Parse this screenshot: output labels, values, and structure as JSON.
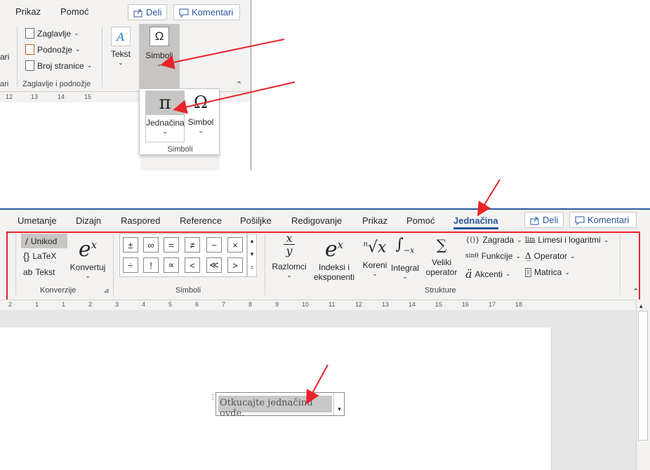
{
  "top": {
    "tabs": [
      "Prikaz",
      "Pomoć"
    ],
    "share_label": "Deli",
    "comments_label": "Komentari",
    "partial_left_text": "ari",
    "header_footer": {
      "items": [
        "Zaglavlje",
        "Podnožje",
        "Broj stranice"
      ],
      "group_label": "Zaglavlje i podnožje"
    },
    "text_button": "Tekst",
    "symbols_button": "Simboli",
    "ruler_ticks": [
      "12",
      "13",
      "14",
      "15"
    ],
    "dropdown": {
      "equation_label": "Jednačina",
      "symbol_label": "Simbol",
      "group_label": "Simboli"
    }
  },
  "bottom": {
    "tabs": [
      "Umetanje",
      "Dizajn",
      "Raspored",
      "Reference",
      "Pošiljke",
      "Redigovanje",
      "Prikaz",
      "Pomoć",
      "Jednačina"
    ],
    "active_tab": "Jednačina",
    "share_label": "Deli",
    "comments_label": "Komentari",
    "conversion": {
      "options": [
        "Unikod",
        "LaTeX",
        "Tekst"
      ],
      "convert_label": "Konvertuj",
      "group_label": "Konverzije"
    },
    "symbols": {
      "row1": [
        "±",
        "∞",
        "=",
        "≠",
        "~",
        "×"
      ],
      "row2": [
        "÷",
        "!",
        "∝",
        "<",
        "≪",
        ">"
      ],
      "group_label": "Simboli"
    },
    "structures": {
      "items": [
        {
          "label1": "Razlomci",
          "label2": ""
        },
        {
          "label1": "Indeksi i",
          "label2": "eksponenti"
        },
        {
          "label1": "Koreni",
          "label2": ""
        },
        {
          "label1": "Integral",
          "label2": ""
        },
        {
          "label1": "Veliki",
          "label2": "operator"
        }
      ],
      "small_items": [
        "Zagrada",
        "Funkcije",
        "Akcenti",
        "Limesi i logaritmi",
        "Operator",
        "Matrica"
      ],
      "group_label": "Strukture"
    },
    "ruler_ticks": [
      "2",
      "1",
      "1",
      "2",
      "3",
      "4",
      "5",
      "6",
      "7",
      "8",
      "9",
      "10",
      "11",
      "12",
      "13",
      "14",
      "15",
      "16",
      "17",
      "18"
    ],
    "equation_placeholder": "Otkucajte jednačinu ovde."
  },
  "colors": {
    "accent": "#2b579a",
    "highlight": "#e8242a"
  }
}
